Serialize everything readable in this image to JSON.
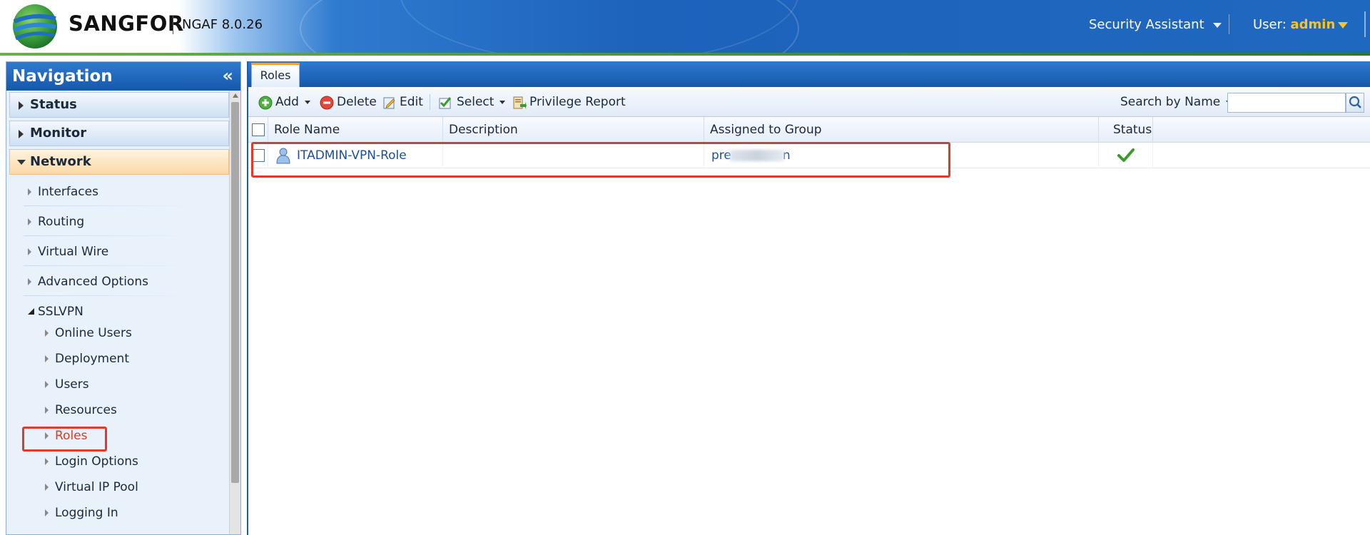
{
  "header": {
    "brand": "SANGFOR",
    "version": "NGAF 8.0.26",
    "security_assistant": "Security Assistant",
    "user_label": "User: ",
    "user_name": "admin"
  },
  "nav": {
    "title": "Navigation",
    "collapse_glyph": "«",
    "categories": [
      {
        "label": "Status",
        "state": "collapsed"
      },
      {
        "label": "Monitor",
        "state": "collapsed"
      },
      {
        "label": "Network",
        "state": "expanded"
      }
    ],
    "items": [
      {
        "label": "Interfaces"
      },
      {
        "label": "Routing"
      },
      {
        "label": "Virtual Wire"
      },
      {
        "label": "Advanced Options"
      }
    ],
    "sslvpn": {
      "label": "SSLVPN",
      "children": [
        {
          "label": "Online Users"
        },
        {
          "label": "Deployment"
        },
        {
          "label": "Users"
        },
        {
          "label": "Resources"
        },
        {
          "label": "Roles",
          "selected": true
        },
        {
          "label": "Login Options"
        },
        {
          "label": "Virtual IP Pool"
        },
        {
          "label": "Logging In"
        }
      ]
    }
  },
  "main": {
    "tab": "Roles",
    "toolbar": {
      "add": "Add",
      "delete": "Delete",
      "edit": "Edit",
      "select": "Select",
      "privilege_report": "Privilege Report",
      "search_label": "Search by Name",
      "search_value": ""
    },
    "table": {
      "columns": [
        "Role Name",
        "Description",
        "Assigned to Group",
        "Status"
      ],
      "rows": [
        {
          "role_name": "ITADMIN-VPN-Role",
          "description": "",
          "group_prefix": "pre",
          "group_suffix": "n",
          "status": "enabled"
        }
      ]
    }
  },
  "colors": {
    "header_blue": "#1d62bb",
    "nav_title_blue": "#1558aa",
    "link_blue": "#1a4f9c",
    "highlight_red": "#dd3b2c",
    "selected_text": "#e03a1e",
    "user_orange": "#f6c22e",
    "status_green": "#3a9a2a"
  }
}
